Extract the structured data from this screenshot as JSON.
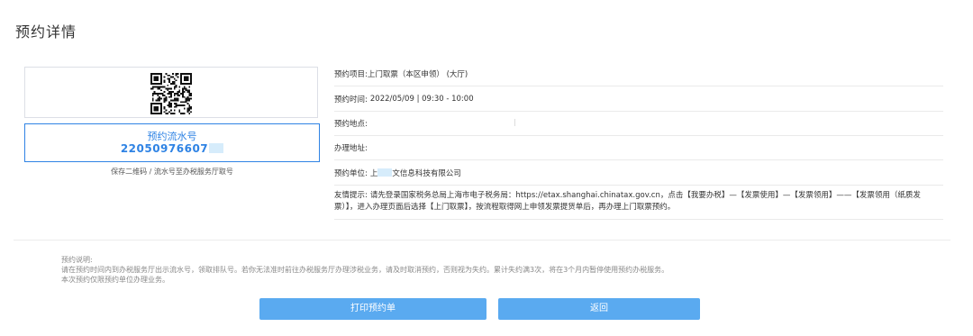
{
  "page_title": "预约详情",
  "left_card": {
    "qr_icon": "qr-code",
    "serial_label": "预约流水号",
    "serial_number": "22050976607",
    "save_tip": "保存二维码 / 流水号至办税服务厅取号"
  },
  "details": {
    "project": {
      "label": "预约项目:",
      "value": "上门取票（本区申领） (大厅)"
    },
    "time": {
      "label": "预约时间:",
      "value": "2022/05/09 | 09:30 - 10:00"
    },
    "location": {
      "label": "预约地点:",
      "value": ""
    },
    "address": {
      "label": "办理地址:",
      "value": ""
    },
    "unit": {
      "label": "预约单位:",
      "value_prefix": "上",
      "value_suffix": "文信息科技有限公司"
    },
    "tip": {
      "label": "友情提示:",
      "value": "请先登录国家税务总局上海市电子税务局：https://etax.shanghai.chinatax.gov.cn，点击【我要办税】—【发票使用】—【发票领用】——【发票领用（纸质发票）】，进入办理页面后选择【上门取票】，按流程取得网上申领发票提货单后，再办理上门取票预约。"
    }
  },
  "notes": {
    "title": "预约说明:",
    "line1": "请在预约时间内到办税服务厅出示流水号，领取排队号。若你无法准时前往办税服务厅办理涉税业务，请及时取消预约，否则视为失约。累计失约满3次，将在3个月内暂停使用预约办税服务。",
    "line2": "本次预约仅限预约单位办理业务。"
  },
  "buttons": {
    "print": "打印预约单",
    "back": "返回"
  },
  "colors": {
    "accent": "#2f83e4",
    "button": "#5aaaf0"
  }
}
